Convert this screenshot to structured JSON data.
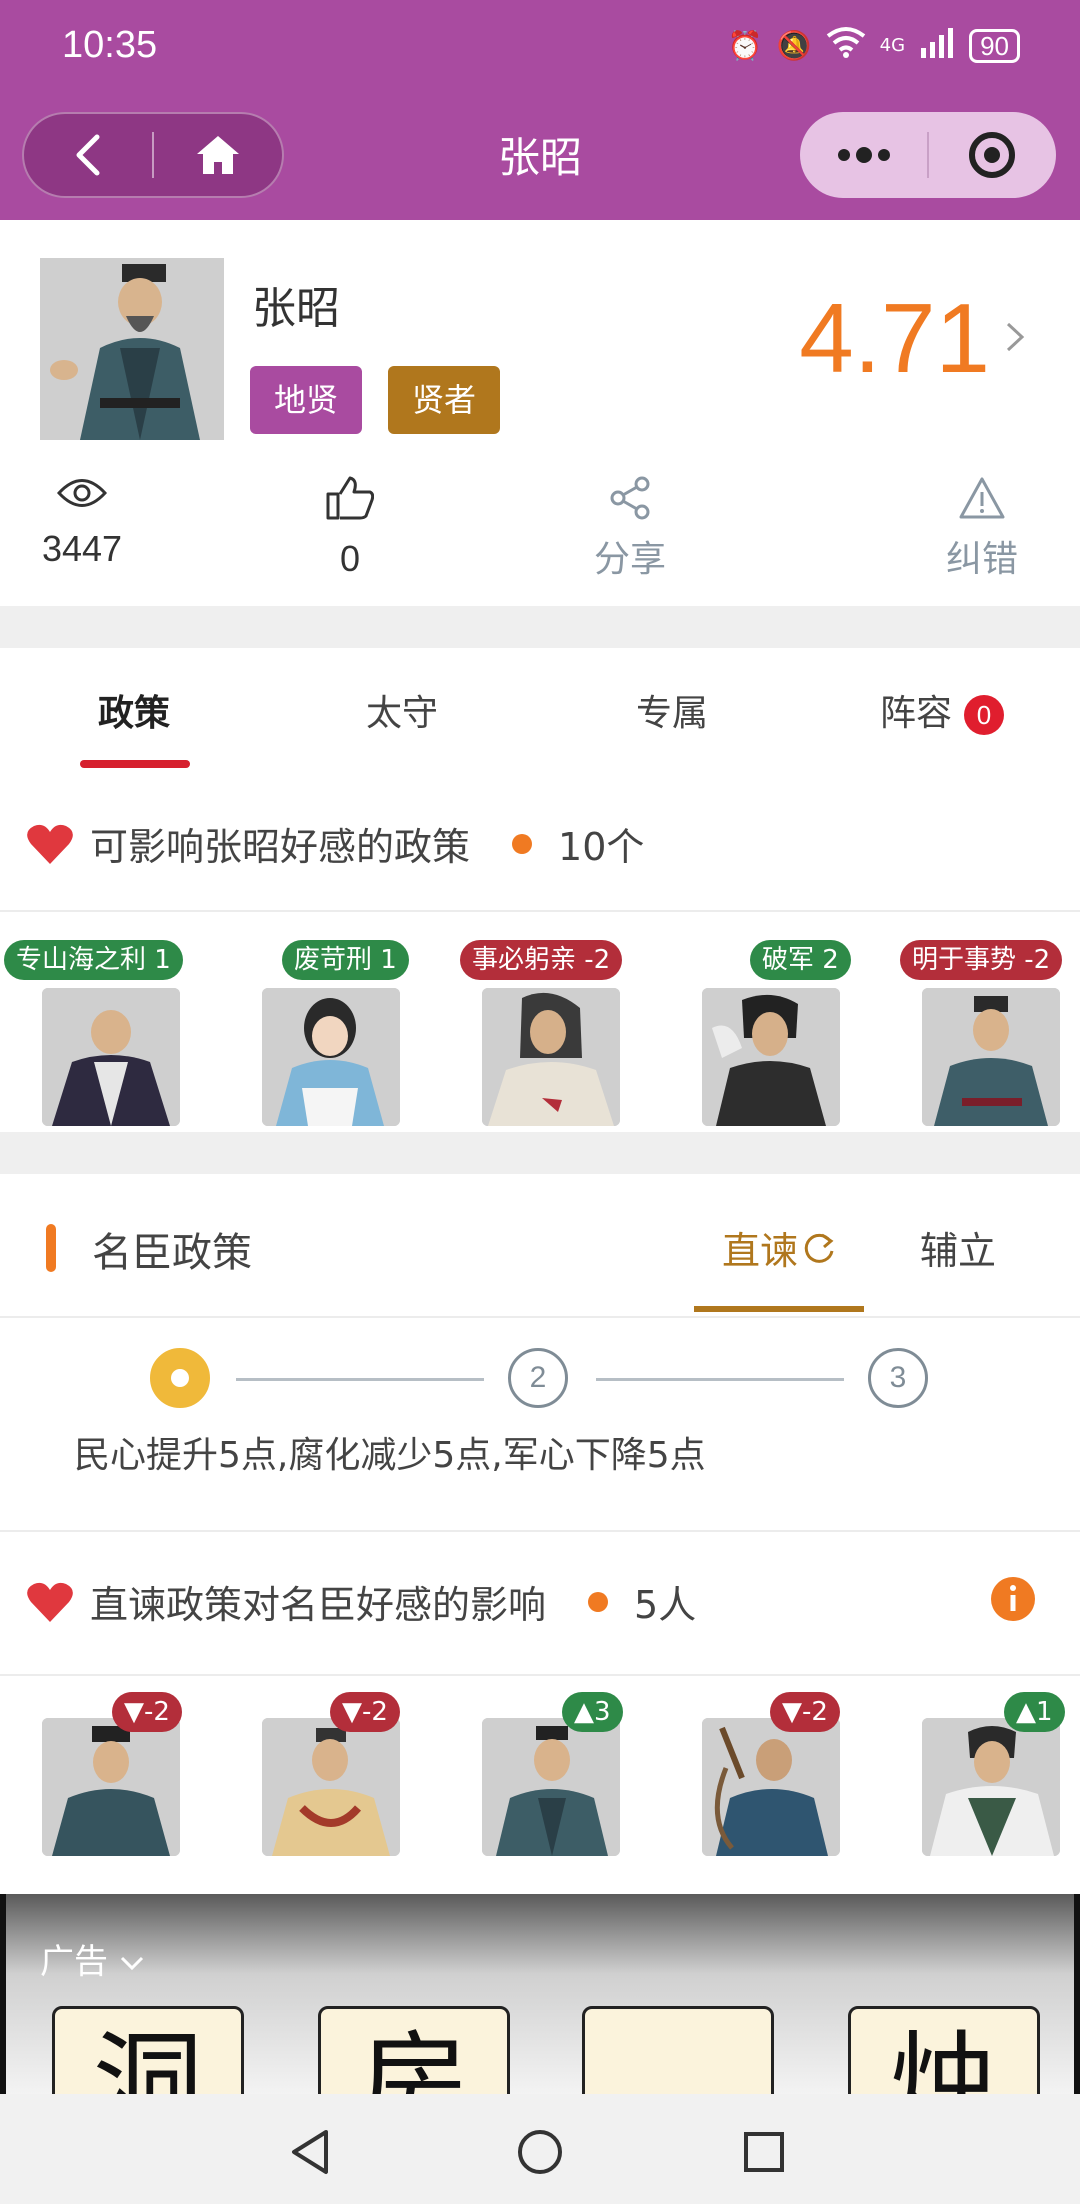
{
  "status": {
    "time": "10:35",
    "network": "4G",
    "battery": "90"
  },
  "nav": {
    "title": "张昭"
  },
  "profile": {
    "name": "张昭",
    "tags": [
      "地贤",
      "贤者"
    ],
    "score": "4.71",
    "views": "3447",
    "likes": "0",
    "share": "分享",
    "report": "纠错"
  },
  "tabs": [
    {
      "label": "政策",
      "active": true
    },
    {
      "label": "太守"
    },
    {
      "label": "专属"
    },
    {
      "label": "阵容",
      "badge": "0"
    }
  ],
  "favor_section": {
    "title": "可影响张昭好感的政策",
    "count": "10个"
  },
  "policy_chars": [
    {
      "label": "专山海之利 1",
      "color": "green"
    },
    {
      "label": "废苛刑 1",
      "color": "green"
    },
    {
      "label": "事必躬亲 -2",
      "color": "red"
    },
    {
      "label": "破军 2",
      "color": "green"
    },
    {
      "label": "明于事势 -2",
      "color": "red"
    }
  ],
  "mingchen": {
    "title": "名臣政策",
    "tab_active": "直谏",
    "tab_other": "辅立",
    "steps": [
      "1",
      "2",
      "3"
    ],
    "description": "民心提升5点,腐化减少5点,军心下降5点"
  },
  "impact_section": {
    "title": "直谏政策对名臣好感的影响",
    "count": "5人"
  },
  "impact_chars": [
    {
      "label": "▼-2",
      "color": "red"
    },
    {
      "label": "▼-2",
      "color": "red"
    },
    {
      "label": "▲3",
      "color": "green"
    },
    {
      "label": "▼-2",
      "color": "red"
    },
    {
      "label": "▲1",
      "color": "green"
    }
  ],
  "ad": {
    "label": "广告",
    "boxes": [
      "洞",
      "房",
      "",
      "烛"
    ]
  },
  "colors": {
    "brand": "#a94ba0",
    "accent": "#f07a22",
    "gold": "#b0771d"
  }
}
